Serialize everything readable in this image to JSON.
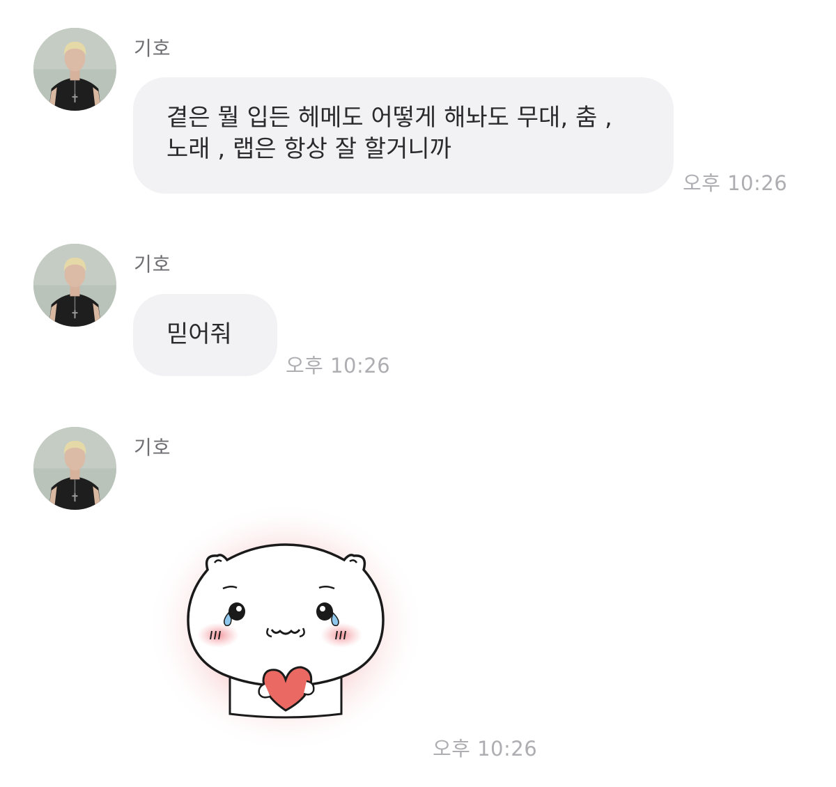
{
  "messages": [
    {
      "sender": "기호",
      "text": "곁은 뭘 입든 헤메도 어떻게 해놔도 무대, 춤 ,\n노래 , 랩은 항상 잘 할거니까",
      "time": "오후 10:26"
    },
    {
      "sender": "기호",
      "text": "믿어줘",
      "time": "오후 10:26"
    },
    {
      "sender": "기호",
      "sticker": "crying-bear-holding-heart-sticker",
      "time": "오후 10:26"
    }
  ],
  "colors": {
    "bubble_bg": "#f2f2f4",
    "text": "#2a2a2e",
    "time": "#aeaeb2",
    "sender": "#6d6d72",
    "heart": "#ea6a63",
    "glow": "#f4b6b8"
  }
}
